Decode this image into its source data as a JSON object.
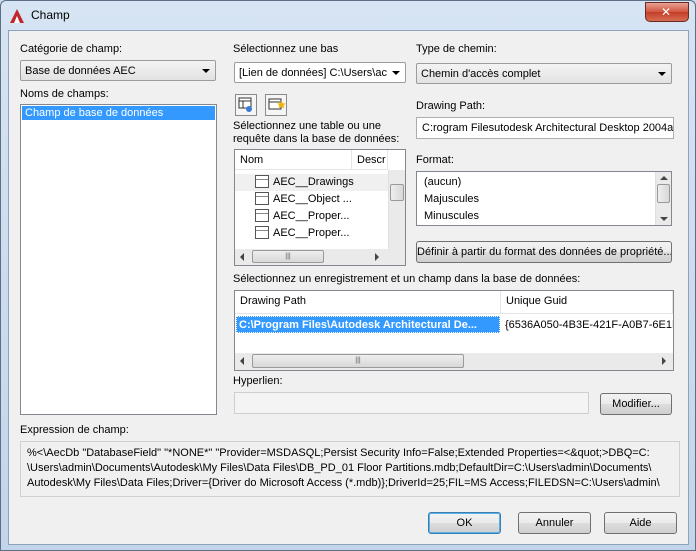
{
  "window": {
    "title": "Champ"
  },
  "field_category": {
    "label": "Catégorie de champ:",
    "value": "Base de données AEC"
  },
  "field_names": {
    "label": "Noms de champs:",
    "items": [
      "Champ de base de données"
    ]
  },
  "database": {
    "label": "Sélectionnez une bas",
    "value": "[Lien de données] C:\\Users\\ac"
  },
  "path_type": {
    "label": "Type de chemin:",
    "value": "Chemin d'accès complet"
  },
  "table_select": {
    "label_line1": "Sélectionnez une table ou une",
    "label_line2": "requête dans la base de données:",
    "columns": [
      "Nom",
      "Descr"
    ],
    "rows": [
      "AEC__Drawings",
      "AEC__Object ...",
      "AEC__Proper...",
      "AEC__Proper..."
    ]
  },
  "drawing_path": {
    "label": "Drawing Path:",
    "value": "C:rogram Filesutodesk Architectural Desktop 2004am"
  },
  "format": {
    "label": "Format:",
    "items": [
      "(aucun)",
      "Majuscules",
      "Minuscules"
    ]
  },
  "define_format_button": "Définir à partir du format des données de propriété...",
  "record_select": {
    "label": "Sélectionnez un enregistrement et un champ dans la base de données:",
    "columns": [
      "Drawing Path",
      "Unique Guid"
    ],
    "row": [
      "C:\\Program Files\\Autodesk Architectural De...",
      "{6536A050-4B3E-421F-A0B7-6E1E"
    ]
  },
  "hyperlink": {
    "label": "Hyperlien:",
    "value": "",
    "modify_button": "Modifier..."
  },
  "expression": {
    "label": "Expression de champ:",
    "line1": "%<\\AecDb \"DatabaseField\" \"*NONE*\" \"Provider=MSDASQL;Persist Security Info=False;Extended Properties=<&quot;>DBQ=C:",
    "line2": "\\Users\\admin\\Documents\\Autodesk\\My Files\\Data Files\\DB_PD_01 Floor Partitions.mdb;DefaultDir=C:\\Users\\admin\\Documents\\",
    "line3": "Autodesk\\My Files\\Data Files;Driver={Driver do Microsoft Access (*.mdb)};DriverId=25;FIL=MS Access;FILEDSN=C:\\Users\\admin\\"
  },
  "buttons": {
    "ok": "OK",
    "cancel": "Annuler",
    "help": "Aide",
    "close_glyph": "✕"
  },
  "scroll_glyph": "|||",
  "colors": {
    "selection": "#3399ff",
    "title_icon": "#c0282d"
  }
}
